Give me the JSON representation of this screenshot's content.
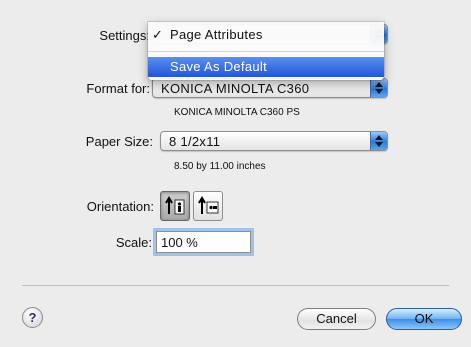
{
  "settings": {
    "label": "Settings:",
    "menu": [
      {
        "label": "Page Attributes",
        "checked": true,
        "check_mark": "✓",
        "selected": false
      },
      {
        "label": "Save As Default",
        "checked": false,
        "check_mark": "",
        "selected": true
      }
    ]
  },
  "format_for": {
    "label": "Format for:",
    "value": "KONICA MINOLTA C360",
    "subtitle": "KONICA MINOLTA C360 PS"
  },
  "paper_size": {
    "label": "Paper Size:",
    "value": "8 1/2x11",
    "subtitle": "8.50 by 11.00 inches"
  },
  "orientation": {
    "label": "Orientation:",
    "options": [
      "portrait-icon",
      "landscape-icon"
    ],
    "selected": "portrait"
  },
  "scale": {
    "label": "Scale:",
    "value": "100 %"
  },
  "buttons": {
    "help": "?",
    "cancel": "Cancel",
    "ok": "OK"
  },
  "colors": {
    "accent": "#2e7ad6",
    "menu_highlight": "#2256d8",
    "background": "#ececec"
  }
}
